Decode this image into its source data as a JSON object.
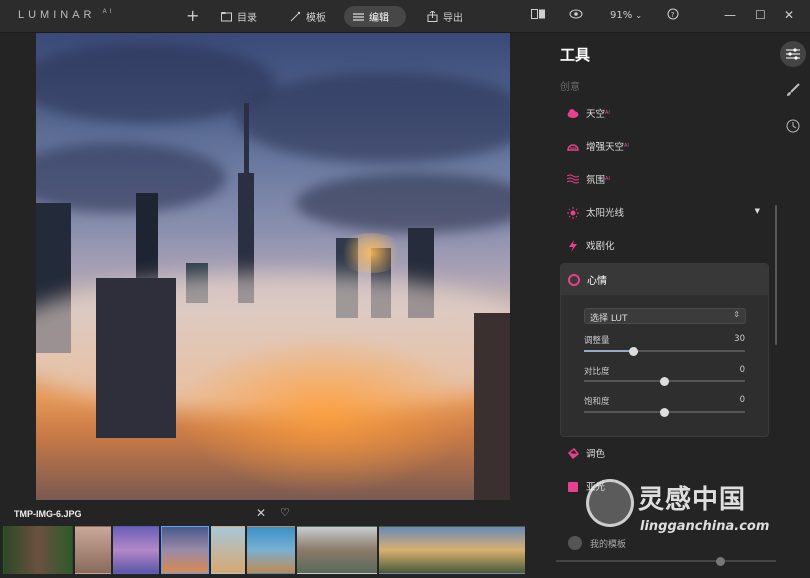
{
  "app": {
    "logo": "LUMINAR",
    "logo_sup": "A I"
  },
  "toolbar": {
    "catalog": "目录",
    "templates": "模板",
    "edit": "编辑",
    "export": "导出",
    "zoom": "91%"
  },
  "image": {
    "filename": "TMP-IMG-6.JPG"
  },
  "panel": {
    "title": "工具",
    "section": "创意",
    "tools": [
      {
        "label": "天空",
        "badge": "AI",
        "icon": "cloud-icon"
      },
      {
        "label": "增强天空",
        "badge": "AI",
        "icon": "sky-enhance-icon"
      },
      {
        "label": "氛围",
        "badge": "AI",
        "icon": "atmosphere-icon"
      },
      {
        "label": "太阳光线",
        "badge": "",
        "icon": "sunrays-icon"
      },
      {
        "label": "戏剧化",
        "badge": "",
        "icon": "lightning-icon"
      }
    ],
    "mood": {
      "label": "心情",
      "lut_placeholder": "选择 LUT",
      "sliders": [
        {
          "label": "调整量",
          "value": "30",
          "fraction": 0.3
        },
        {
          "label": "对比度",
          "value": "0",
          "fraction": 0.5
        },
        {
          "label": "饱和度",
          "value": "0",
          "fraction": 0.5
        }
      ]
    },
    "tools_after": [
      {
        "label": "调色",
        "icon": "bucket-icon"
      },
      {
        "label": "亚光",
        "icon": "matte-icon"
      }
    ],
    "my_templates": "我的模板"
  },
  "watermark": {
    "text": "灵感中国",
    "url": "lingganchina.com"
  },
  "colors": {
    "accent": "#e8408e",
    "active_tab": "#474747",
    "panel_bg": "#242424"
  }
}
